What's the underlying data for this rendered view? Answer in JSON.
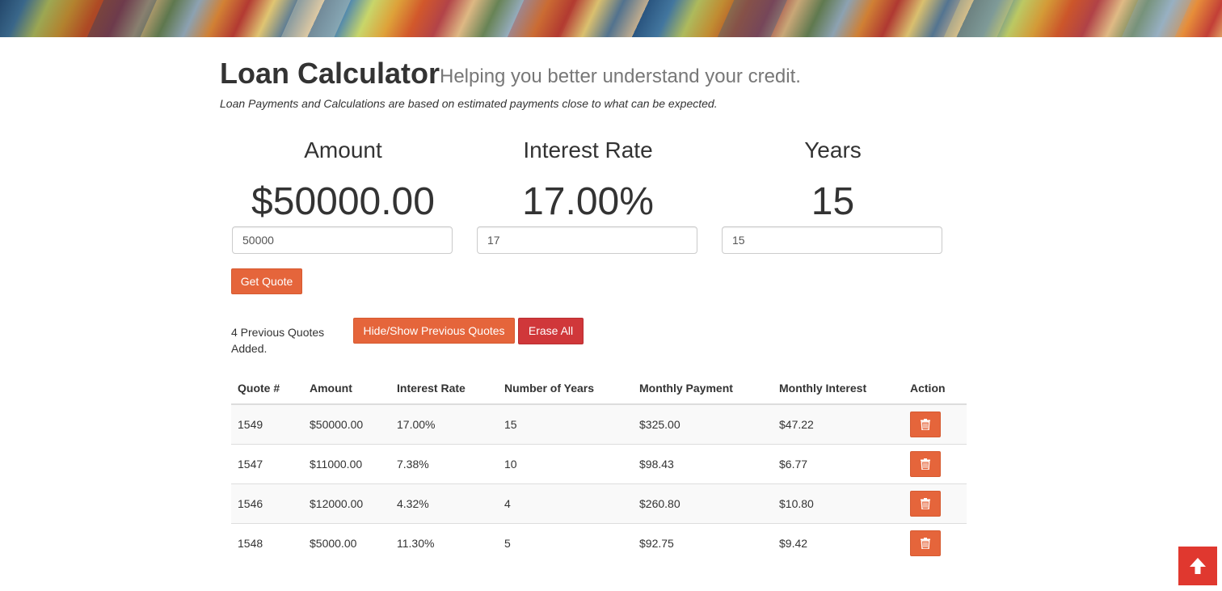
{
  "header": {
    "title": "Loan Calculator",
    "subtitle": "Helping you better understand your credit.",
    "note": "Loan Payments and Calculations are based on estimated payments close to what can be expected."
  },
  "stats": {
    "amount": {
      "label": "Amount",
      "value": "$50000.00",
      "input_value": "50000"
    },
    "rate": {
      "label": "Interest Rate",
      "value": "17.00%",
      "input_value": "17"
    },
    "years": {
      "label": "Years",
      "value": "15",
      "input_value": "15"
    }
  },
  "buttons": {
    "get_quote": "Get Quote",
    "toggle_previous": "Hide/Show Previous Quotes",
    "erase_all": "Erase All"
  },
  "quotes_status": "4 Previous Quotes Added.",
  "table": {
    "headers": [
      "Quote #",
      "Amount",
      "Interest Rate",
      "Number of Years",
      "Monthly Payment",
      "Monthly Interest",
      "Action"
    ],
    "rows": [
      {
        "quote": "1549",
        "amount": "$50000.00",
        "rate": "17.00%",
        "years": "15",
        "payment": "$325.00",
        "interest": "$47.22"
      },
      {
        "quote": "1547",
        "amount": "$11000.00",
        "rate": "7.38%",
        "years": "10",
        "payment": "$98.43",
        "interest": "$6.77"
      },
      {
        "quote": "1546",
        "amount": "$12000.00",
        "rate": "4.32%",
        "years": "4",
        "payment": "$260.80",
        "interest": "$10.80"
      },
      {
        "quote": "1548",
        "amount": "$5000.00",
        "rate": "11.30%",
        "years": "5",
        "payment": "$92.75",
        "interest": "$9.42"
      }
    ]
  },
  "icons": {
    "banner": "currency-banner-image",
    "delete": "trash-icon",
    "scroll_top": "arrow-up-icon"
  },
  "colors": {
    "accent": "#e5653b",
    "danger": "#d0373a",
    "scroll_top": "#e0382f"
  }
}
